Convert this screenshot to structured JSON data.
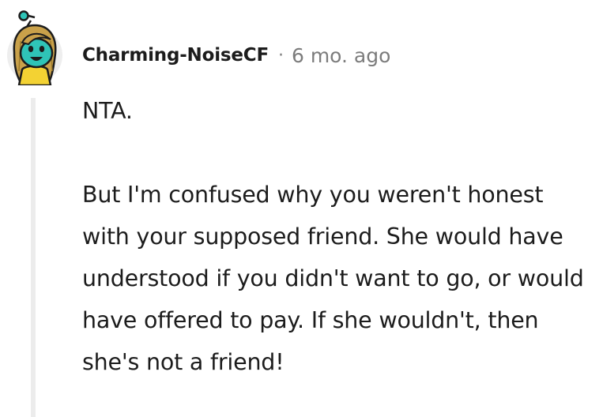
{
  "comment": {
    "author": "Charming-NoiseCF",
    "separator": "·",
    "timestamp": "6 mo. ago",
    "paragraphs": [
      "NTA.",
      "But I'm confused why you weren't honest with your supposed friend. She would have understood if you didn't want to go, or would have offered to pay. If she wouldn't, then she's not a friend!"
    ],
    "avatar": {
      "icon": "snoo-avatar-icon",
      "colors": {
        "hair": "#c9a14a",
        "face": "#2fc4b7",
        "shirt": "#f3d233",
        "background": "#eeeeee"
      }
    }
  },
  "colors": {
    "text": "#1c1c1c",
    "meta": "#7c7c7c",
    "thread_line": "#ececec"
  }
}
